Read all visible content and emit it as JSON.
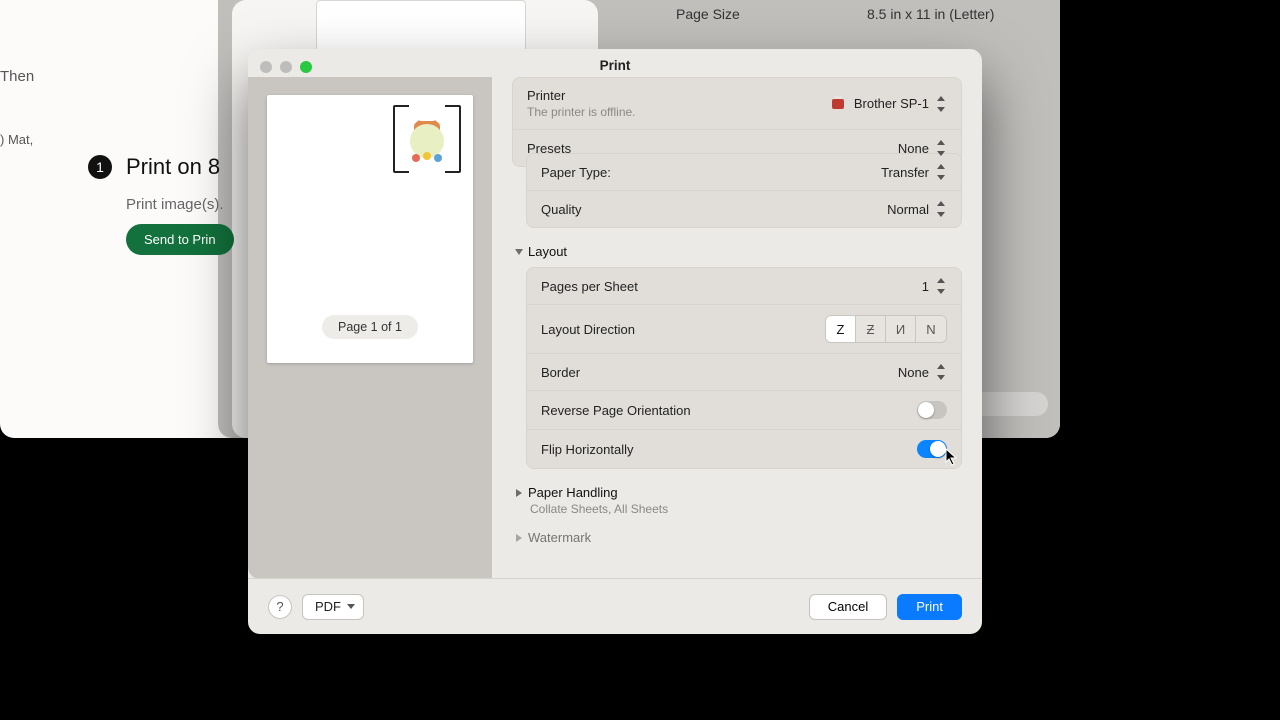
{
  "background": {
    "then": "Then",
    "mat": ") Mat,",
    "step_number": "1",
    "step_title": "Print on 8",
    "step_sub": "Print image(s).",
    "send_btn": "Send to Prin",
    "page_size_label": "Page Size",
    "page_size_value": "8.5 in x 11 in (Letter)"
  },
  "dialog": {
    "title": "Print",
    "preview_badge": "Page 1 of 1",
    "printer": {
      "label": "Printer",
      "value": "Brother SP-1",
      "sub": "The printer is offline."
    },
    "presets": {
      "label": "Presets",
      "value": "None"
    },
    "paper_type": {
      "label": "Paper Type:",
      "value": "Transfer"
    },
    "quality": {
      "label": "Quality",
      "value": "Normal"
    },
    "section_layout": "Layout",
    "pages_per_sheet": {
      "label": "Pages per Sheet",
      "value": "1"
    },
    "layout_direction": {
      "label": "Layout Direction",
      "options": [
        "Z",
        "Ƶ",
        "И",
        "N"
      ],
      "active_index": 0
    },
    "border": {
      "label": "Border",
      "value": "None"
    },
    "reverse": {
      "label": "Reverse Page Orientation",
      "on": false
    },
    "flip": {
      "label": "Flip Horizontally",
      "on": true
    },
    "section_paper_handling": "Paper Handling",
    "paper_handling_sub": "Collate Sheets, All Sheets",
    "section_watermark": "Watermark",
    "footer": {
      "help": "?",
      "pdf": "PDF",
      "cancel": "Cancel",
      "print": "Print"
    }
  }
}
